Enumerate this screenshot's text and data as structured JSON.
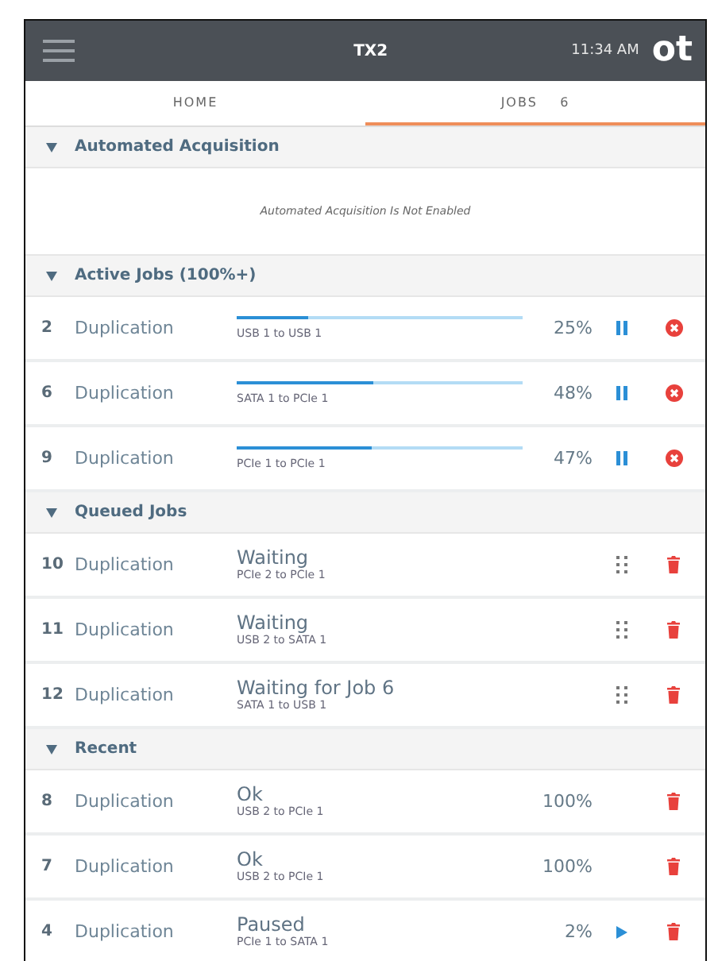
{
  "header": {
    "title": "TX2",
    "time": "11:34 AM",
    "logo": "ot"
  },
  "tabs": [
    {
      "label": "HOME",
      "selected": false
    },
    {
      "label": "JOBS",
      "count": "6",
      "selected": true
    }
  ],
  "sections": [
    {
      "title": "Automated Acquisition",
      "expanded": true,
      "empty_message": "Automated Acquisition Is Not Enabled"
    },
    {
      "title": "Active Jobs (100%+)",
      "expanded": true,
      "jobs": [
        {
          "kind": "active",
          "number": "2",
          "type": "Duplication",
          "route": "USB 1 to USB 1",
          "level": 0.25,
          "percent": "25%"
        },
        {
          "kind": "active",
          "number": "6",
          "type": "Duplication",
          "route": "SATA 1 to PCIe 1",
          "level": 0.48,
          "percent": "48%"
        },
        {
          "kind": "active",
          "number": "9",
          "type": "Duplication",
          "route": "PCIe 1 to PCIe 1",
          "level": 0.47,
          "percent": "47%"
        }
      ]
    },
    {
      "title": "Queued Jobs",
      "expanded": true,
      "jobs": [
        {
          "kind": "queued",
          "number": "10",
          "type": "Duplication",
          "status": "Waiting",
          "route": "PCIe 2 to PCIe 1"
        },
        {
          "kind": "queued",
          "number": "11",
          "type": "Duplication",
          "status": "Waiting",
          "route": "USB 2 to SATA 1"
        },
        {
          "kind": "queued",
          "number": "12",
          "type": "Duplication",
          "status": "Waiting for Job 6",
          "route": "SATA 1 to USB 1"
        }
      ]
    },
    {
      "title": "Recent",
      "expanded": true,
      "jobs": [
        {
          "kind": "recent",
          "number": "8",
          "type": "Duplication",
          "status": "Ok",
          "route": "USB 2 to PCIe 1",
          "percent": "100%",
          "paused": false
        },
        {
          "kind": "recent",
          "number": "7",
          "type": "Duplication",
          "status": "Ok",
          "route": "USB 2 to PCIe 1",
          "percent": "100%",
          "paused": false
        },
        {
          "kind": "recent",
          "number": "4",
          "type": "Duplication",
          "status": "Paused",
          "route": "PCIe 1 to SATA 1",
          "percent": "2%",
          "paused": true
        }
      ]
    }
  ]
}
